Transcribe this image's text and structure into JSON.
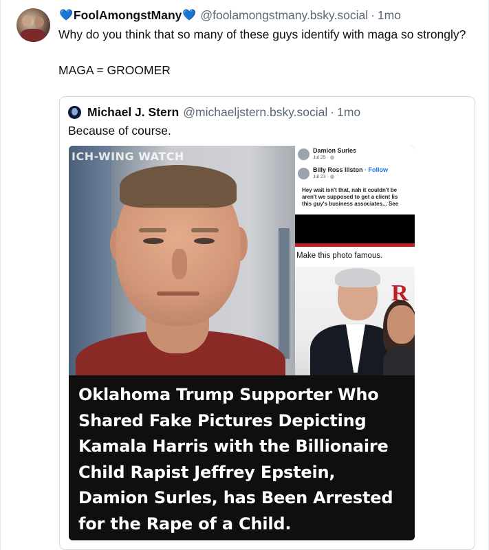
{
  "post": {
    "display_name": "FoolAmongstMany",
    "handle": "@foolamongstmany.bsky.social",
    "separator": "·",
    "time": "1mo",
    "text_lines": [
      "Why do you think that so many of these guys identify with maga so strongly?",
      "MAGA = GROOMER"
    ]
  },
  "quote": {
    "display_name": "Michael J. Stern",
    "handle": "@michaeljstern.bsky.social",
    "separator": "·",
    "time": "1mo",
    "text": "Because of course."
  },
  "media": {
    "watermark": "ICH-WING WATCH",
    "fb_post1_name": "Damion Surles",
    "fb_post1_date": "Jul 25 · ",
    "fb_post2_name": "Billy Ross Illston",
    "fb_post2_follow": " · Follow",
    "fb_post2_date": "Jul 23 · ",
    "fb_comment": "Hey wait isn't that, nah it couldn't be\naren't we supposed to get a client lis\nthis guy's business associates... See",
    "caption": "Make this photo famous.",
    "headline_lines": [
      "Oklahoma Trump Supporter Who",
      "Shared Fake Pictures Depicting",
      "Kamala Harris with the Billionaire",
      "Child Rapist Jeffrey Epstein,",
      "Damion Surles, has Been Arrested",
      "for the Rape of a Child."
    ]
  },
  "colors": {
    "accent_blue": "#2f7bea",
    "muted_text": "#5b6775",
    "border": "#d4d9de"
  },
  "icons": [
    "blue-heart-icon",
    "avatar-image"
  ]
}
